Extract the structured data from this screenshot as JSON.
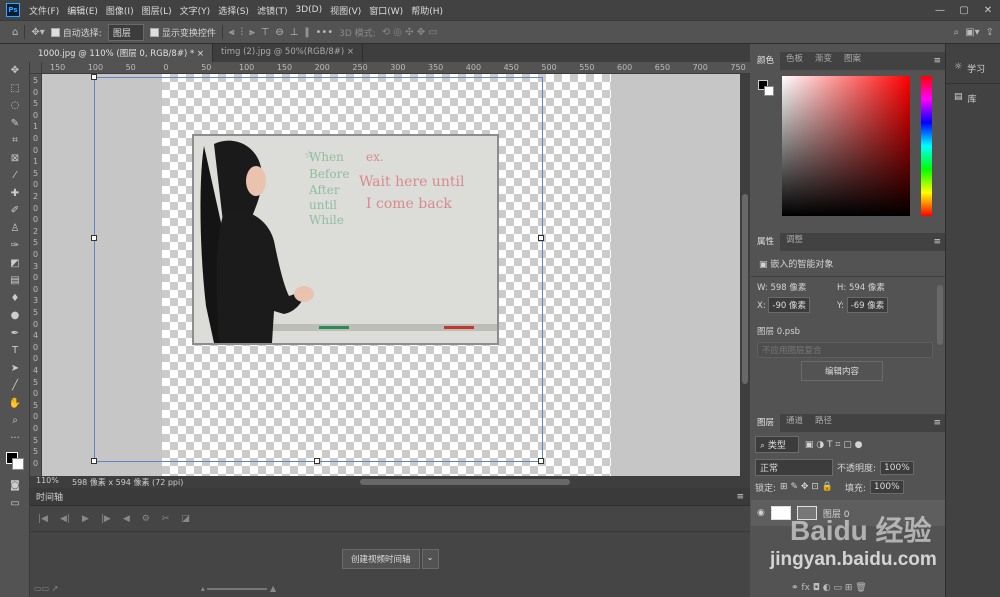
{
  "app": {
    "logo": "Ps"
  },
  "menu": [
    "文件(F)",
    "编辑(E)",
    "图像(I)",
    "图层(L)",
    "文字(Y)",
    "选择(S)",
    "滤镜(T)",
    "3D(D)",
    "视图(V)",
    "窗口(W)",
    "帮助(H)"
  ],
  "window_controls": [
    "—",
    "▢",
    "✕"
  ],
  "options": {
    "auto_select_label": "自动选择:",
    "auto_select_value": "图层",
    "show_transform_label": "显示变换控件",
    "mode_3d_label": "3D 模式:",
    "more": "•••"
  },
  "tabs": [
    {
      "label": "1000.jpg @ 110% (图层 0, RGB/8#) *",
      "close": "×"
    },
    {
      "label": "timg (2).jpg @ 50%(RGB/8#)",
      "close": "×"
    }
  ],
  "ruler_h": [
    "150",
    "100",
    "50",
    "0",
    "50",
    "100",
    "150",
    "200",
    "250",
    "300",
    "350",
    "400",
    "450",
    "500",
    "550",
    "600",
    "650",
    "700",
    "750"
  ],
  "ruler_v": [
    "5",
    "0",
    "5",
    "0",
    "1",
    "0",
    "0",
    "1",
    "5",
    "0",
    "2",
    "0",
    "0",
    "2",
    "5",
    "0",
    "3",
    "0",
    "0",
    "3",
    "5",
    "0",
    "4",
    "0",
    "0",
    "4",
    "5",
    "0",
    "5",
    "0",
    "0",
    "5",
    "5",
    "0"
  ],
  "image_text": {
    "star": "☆",
    "list": [
      "When",
      "Before",
      "After",
      "until",
      "While"
    ],
    "ex": "ex.",
    "line1": "Wait here until",
    "line2": "I come back"
  },
  "status": {
    "zoom": "110%",
    "info": "598 像素 x 594 像素 (72 ppi)"
  },
  "timeline": {
    "title": "时间轴",
    "create_button": "创建视频时间轴"
  },
  "color_panel": {
    "tabs": [
      "颜色",
      "色板",
      "渐变",
      "图案"
    ]
  },
  "properties_panel": {
    "tabs": [
      "属性",
      "调整"
    ],
    "type": "嵌入的智能对象",
    "w_label": "W:",
    "w_value": "598 像素",
    "h_label": "H:",
    "h_value": "594 像素",
    "x_label": "X:",
    "x_value": "-90 像素",
    "y_label": "Y:",
    "y_value": "-69 像素",
    "source": "图层 0.psb",
    "comp_select": "不应用图层复合",
    "edit_button": "编辑内容"
  },
  "layers_panel": {
    "tabs": [
      "图层",
      "通道",
      "路径"
    ],
    "filter": "类型",
    "blend_mode": "正常",
    "opacity_label": "不透明度:",
    "opacity_value": "100%",
    "lock_label": "锁定:",
    "fill_label": "填充:",
    "fill_value": "100%",
    "layer_name": "图层 0"
  },
  "right_strip": {
    "learn": "学习",
    "library": "库"
  },
  "watermark": {
    "brand": "Baidu 经验",
    "url": "jingyan.baidu.com"
  },
  "colors": {
    "foreground": "#000000",
    "background": "#ffffff",
    "bbox": "#5f86c9",
    "marker_text": "#8fbf9e",
    "red_text": "#d88a90"
  }
}
